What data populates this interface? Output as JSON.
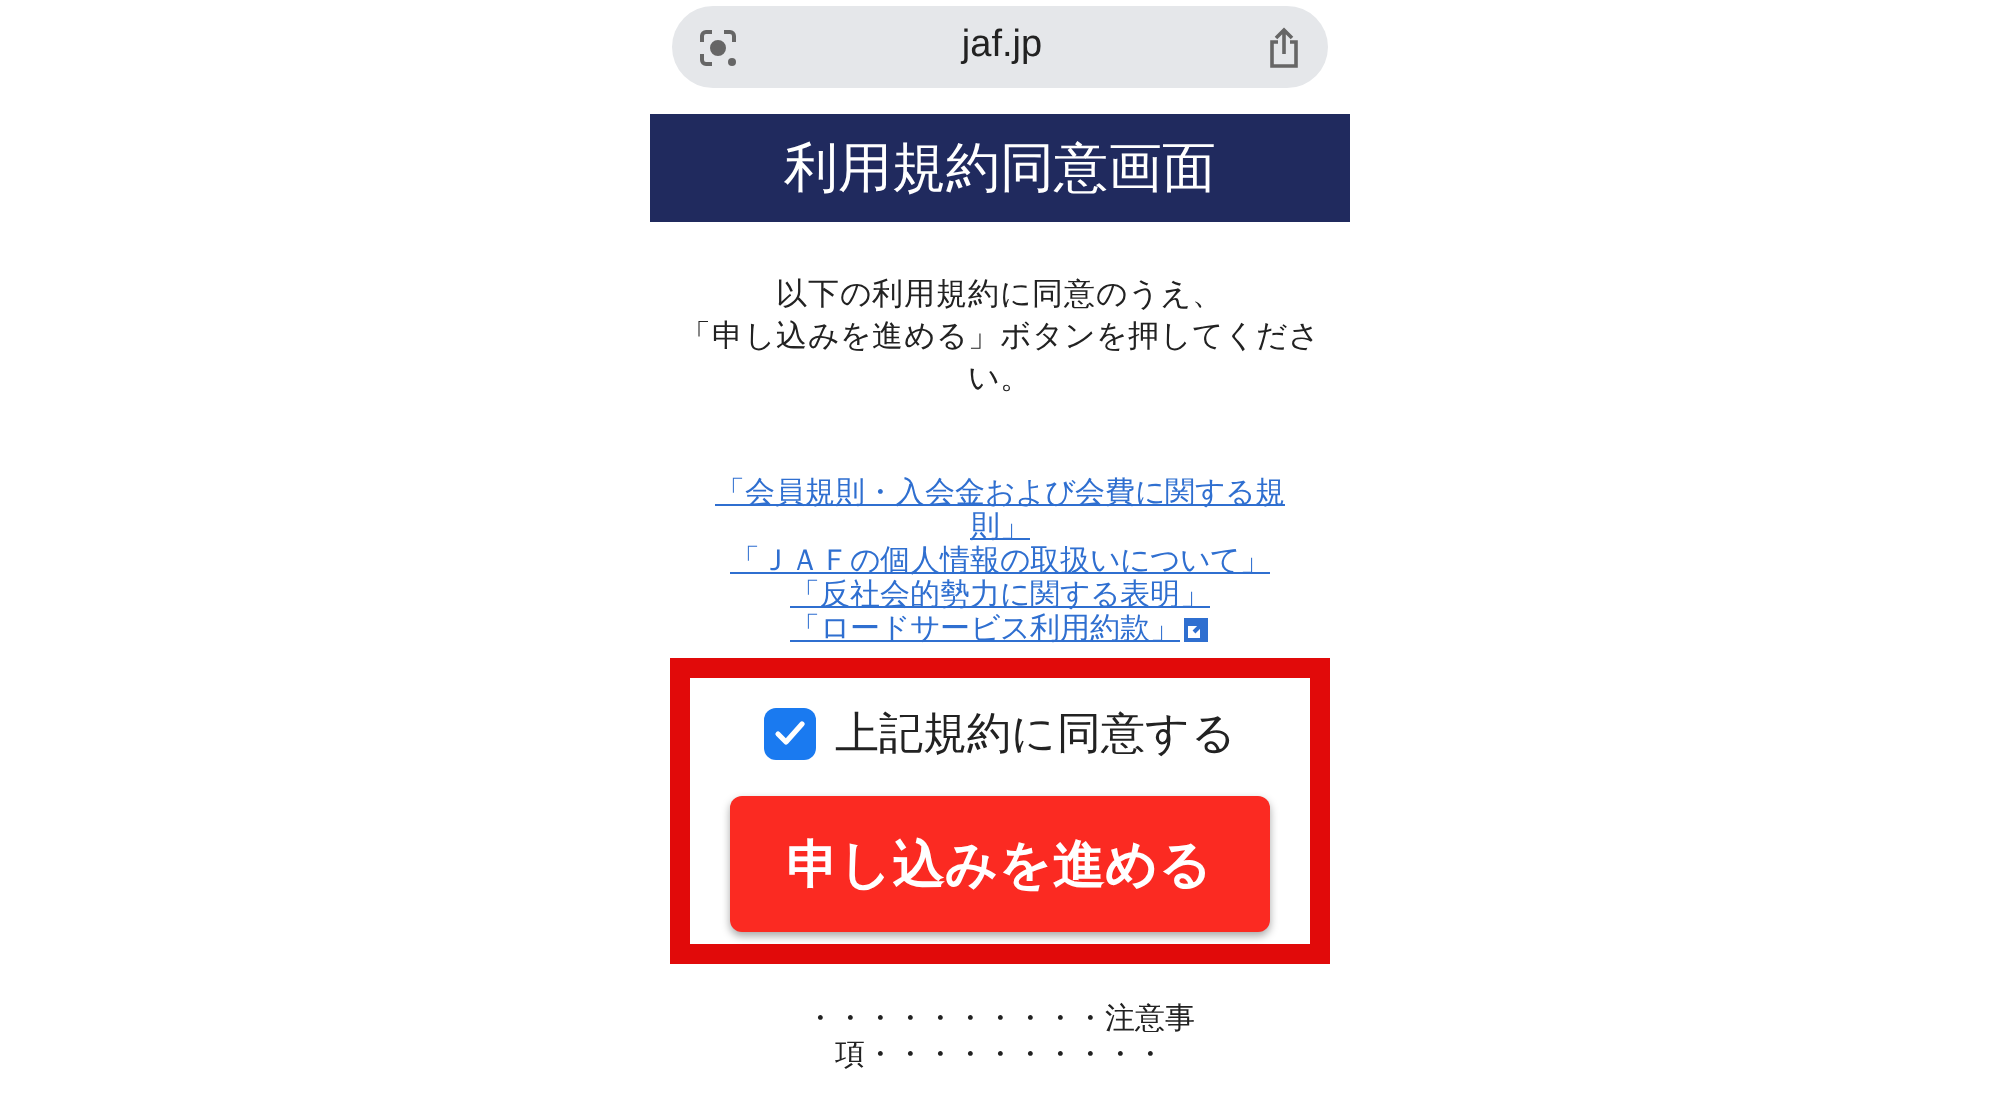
{
  "address_bar": {
    "url": "jaf.jp"
  },
  "header": {
    "title": "利用規約同意画面"
  },
  "instructions": [
    "以下の利用規約に同意のうえ、",
    "「申し込みを進める」ボタンを押してください。"
  ],
  "links": [
    {
      "label": "「会員規則・入会金および会費に関する規則」",
      "external": false
    },
    {
      "label": "「ＪＡＦの個人情報の取扱いについて」",
      "external": false
    },
    {
      "label": "「反社会的勢力に関する表明」",
      "external": false
    },
    {
      "label": "「ロードサービス利用約款」",
      "external": true
    }
  ],
  "agreement": {
    "label": "上記規約に同意する",
    "checked": true
  },
  "submit_button": {
    "label": "申し込みを進める"
  },
  "notice": {
    "text": "・・・・・・・・・・注意事項・・・・・・・・・・"
  }
}
